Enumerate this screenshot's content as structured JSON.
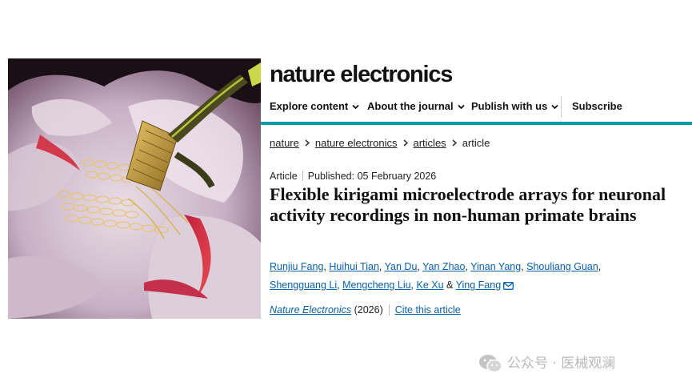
{
  "site": {
    "logo": "nature electronics"
  },
  "nav": {
    "items": [
      {
        "label": "Explore content"
      },
      {
        "label": "About the journal"
      },
      {
        "label": "Publish with us"
      }
    ],
    "subscribe": "Subscribe"
  },
  "breadcrumb": {
    "items": [
      "nature",
      "nature electronics",
      "articles"
    ],
    "current": "article"
  },
  "article": {
    "type": "Article",
    "published": "Published: 05 February 2026",
    "title": "Flexible kirigami microelectrode arrays for neuronal activity recordings in non-human primate brains",
    "authors": [
      "Runjiu Fang",
      "Huihui Tian",
      "Yan Du",
      "Yan Zhao",
      "Yinan Yang",
      "Shouliang Guan",
      "Shengguang Li",
      "Mengcheng Liu",
      "Ke Xu"
    ],
    "last_author": "Ying Fang",
    "journal": "Nature Electronics",
    "year": "(2026)",
    "cite_label": "Cite this article"
  },
  "watermark": {
    "text": "公众号 · 医械观澜"
  },
  "colors": {
    "accent": "#069ea3",
    "link": "#0a5fa8"
  }
}
